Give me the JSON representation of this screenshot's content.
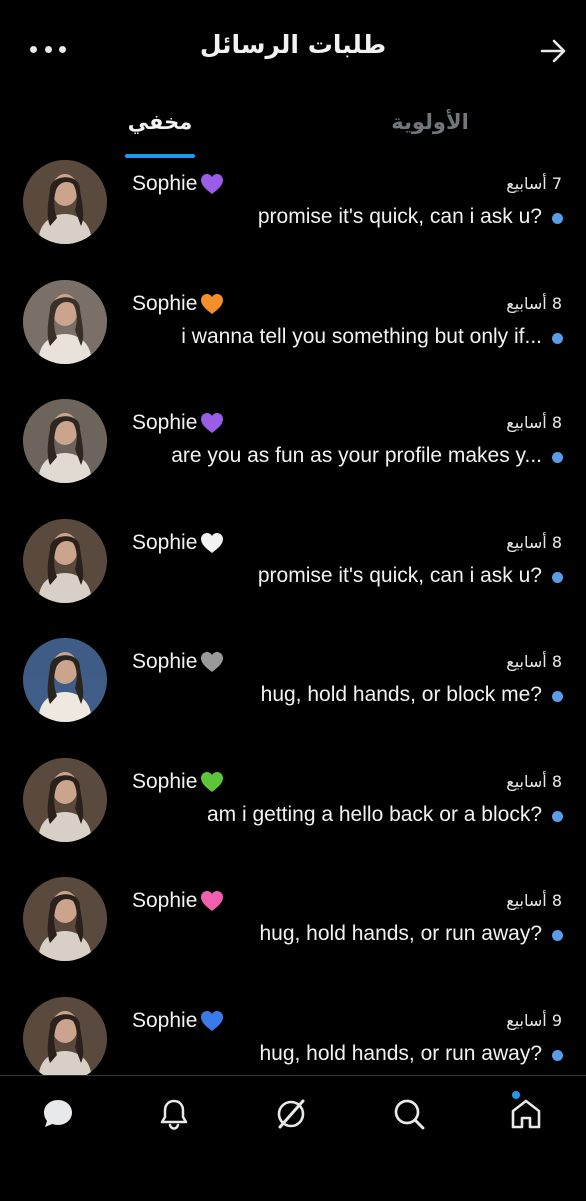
{
  "header": {
    "title": "طلبات الرسائل",
    "back_icon": "arrow-right-icon",
    "more_icon": "more-horizontal-icon"
  },
  "tabs": [
    {
      "label": "مخفي",
      "active": true
    },
    {
      "label": "الأولوية",
      "active": false
    }
  ],
  "requests": [
    {
      "name": "Sophie",
      "heart": "purple-heart",
      "heart_color": "#9b5de5",
      "time": "7 أسابيع",
      "message": "promise it's quick, can i ask u?"
    },
    {
      "name": "Sophie",
      "heart": "orange-heart",
      "heart_color": "#f4902c",
      "time": "8 أسابيع",
      "message": "i wanna tell you something but only if..."
    },
    {
      "name": "Sophie",
      "heart": "purple-heart",
      "heart_color": "#9b5de5",
      "time": "8 أسابيع",
      "message": "are you as fun as your profile makes y..."
    },
    {
      "name": "Sophie",
      "heart": "white-heart",
      "heart_color": "#f2f2f2",
      "time": "8 أسابيع",
      "message": "promise it's quick, can i ask u?"
    },
    {
      "name": "Sophie",
      "heart": "grey-heart",
      "heart_color": "#9a9a9a",
      "time": "8 أسابيع",
      "message": "hug, hold hands, or block me?"
    },
    {
      "name": "Sophie",
      "heart": "green-heart",
      "heart_color": "#5ec43a",
      "time": "8 أسابيع",
      "message": "am i getting a hello back or a block?"
    },
    {
      "name": "Sophie",
      "heart": "pink-heart",
      "heart_color": "#f25fae",
      "time": "8 أسابيع",
      "message": "hug, hold hands, or run away?"
    },
    {
      "name": "Sophie",
      "heart": "blue-heart",
      "heart_color": "#3a7bea",
      "time": "9 أسابيع",
      "message": "hug, hold hands, or run away?"
    }
  ],
  "unread_dot_color": "#5b9ce6",
  "accent_color": "#1d9bf0",
  "bottom_nav": [
    {
      "icon": "messages-icon"
    },
    {
      "icon": "notifications-bell-icon"
    },
    {
      "icon": "grok-icon"
    },
    {
      "icon": "search-icon"
    },
    {
      "icon": "home-icon",
      "badge": true
    }
  ]
}
